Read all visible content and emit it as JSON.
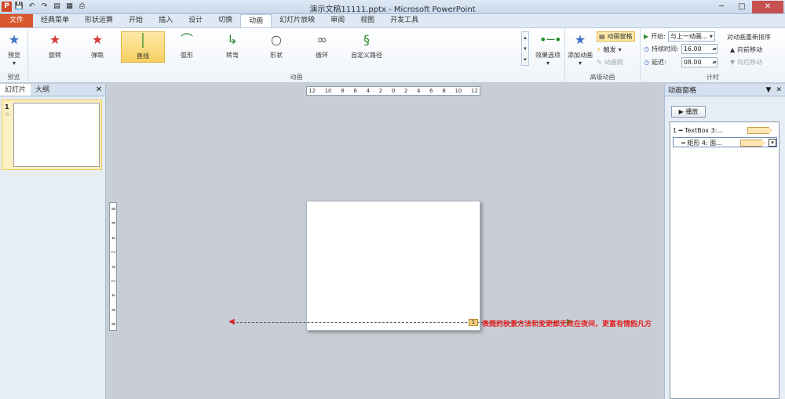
{
  "window": {
    "title": "演示文稿11111.pptx - Microsoft PowerPoint",
    "controls": {
      "minimize": "─",
      "maximize": "□",
      "close": "✕"
    }
  },
  "tabs": [
    "文件",
    "经典菜单",
    "形状运算",
    "开始",
    "插入",
    "设计",
    "切换",
    "动画",
    "幻灯片放映",
    "审阅",
    "视图",
    "开发工具"
  ],
  "ribbon": {
    "preview": {
      "label": "预览",
      "group": "预览"
    },
    "animations": [
      {
        "label": "旋转",
        "icon": "★"
      },
      {
        "label": "弹跳",
        "icon": "★"
      },
      {
        "label": "直线",
        "icon": "│"
      },
      {
        "label": "弧形",
        "icon": "⌒"
      },
      {
        "label": "转弯",
        "icon": "↳"
      },
      {
        "label": "形状",
        "icon": "○"
      },
      {
        "label": "循环",
        "icon": "∞"
      },
      {
        "label": "自定义路径",
        "icon": "§"
      }
    ],
    "effect_options": "效果选项",
    "group_animation": "动画",
    "add_animation": "添加动画",
    "anim_pane": "动画窗格",
    "trigger": "触发",
    "anim_painter": "动画刷",
    "group_advanced": "高级动画",
    "start_label": "开始:",
    "start_value": "与上一动画...",
    "duration_label": "持续时间:",
    "duration_value": "16.00",
    "delay_label": "延迟:",
    "delay_value": "08.00",
    "group_timing": "计时",
    "reorder_title": "对动画重新排序",
    "move_earlier": "向前移动",
    "move_later": "向后移动"
  },
  "left_panel": {
    "tab_slides": "幻灯片",
    "tab_outline": "大纲",
    "close": "✕",
    "slide_number": "1",
    "slide_anim_mark": "☆"
  },
  "canvas": {
    "hruler": [
      "12",
      "10",
      "8",
      "6",
      "4",
      "2",
      "0",
      "2",
      "4",
      "6",
      "8",
      "10",
      "12"
    ],
    "vruler": [
      "8",
      "6",
      "4",
      "2",
      "0",
      "2",
      "4",
      "6",
      "8"
    ],
    "anim_tag": "1",
    "slide_text": "表阁的秋景方法和变更都无政在夜间，更富有情韵凡方"
  },
  "anim_pane": {
    "title": "动画窗格",
    "play": "▶ 播放",
    "items": [
      {
        "text": "1 ━ TextBox 3:..."
      },
      {
        "text": "━ 矩形 4: 面..."
      }
    ]
  }
}
